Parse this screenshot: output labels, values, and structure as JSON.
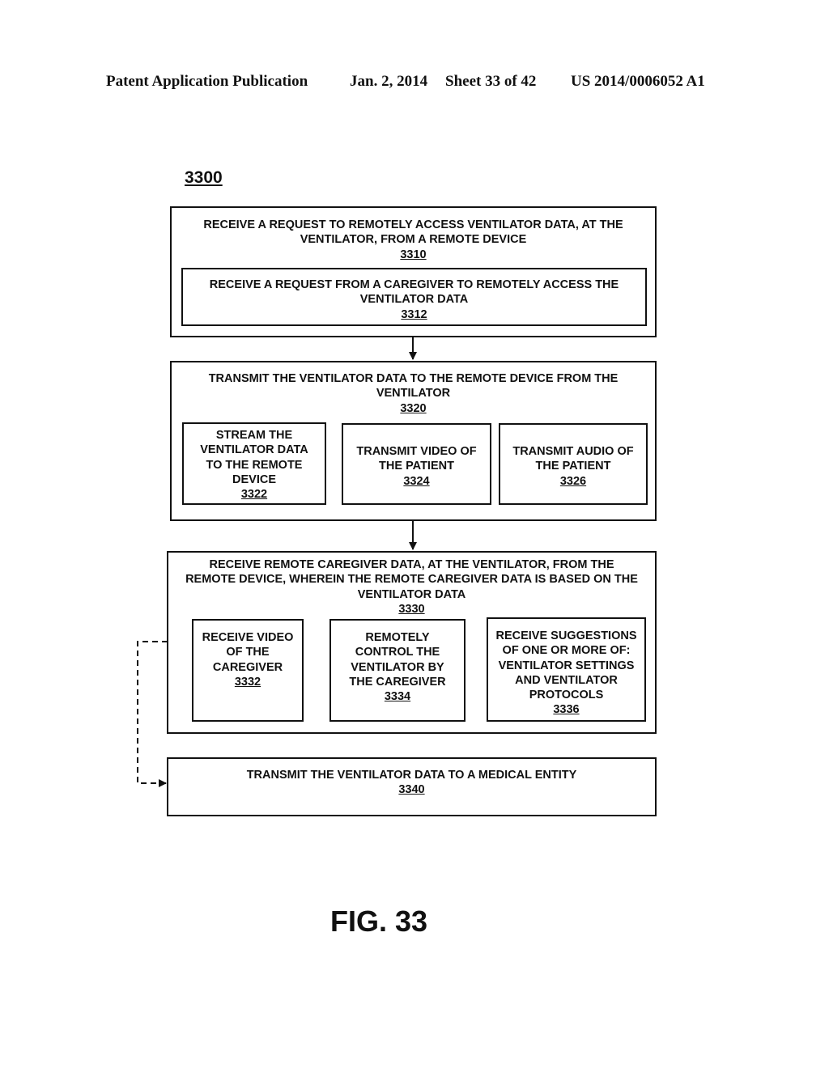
{
  "header": {
    "publication": "Patent Application Publication",
    "date": "Jan. 2, 2014",
    "sheet": "Sheet 33 of 42",
    "number": "US 2014/0006052 A1"
  },
  "diagram": {
    "ref": "3300",
    "figure_label": "FIG. 33",
    "steps": [
      {
        "label": "RECEIVE A REQUEST TO REMOTELY ACCESS VENTILATOR DATA, AT THE\nVENTILATOR, FROM A REMOTE DEVICE",
        "ref": "3310",
        "substeps": [
          {
            "label": "RECEIVE A REQUEST FROM A CAREGIVER TO REMOTELY ACCESS THE\nVENTILATOR DATA",
            "ref": "3312"
          }
        ]
      },
      {
        "label": "TRANSMIT THE VENTILATOR DATA TO THE REMOTE DEVICE FROM THE\nVENTILATOR",
        "ref": "3320",
        "substeps": [
          {
            "label": "STREAM THE\nVENTILATOR DATA\nTO THE REMOTE\nDEVICE",
            "ref": "3322"
          },
          {
            "label": "TRANSMIT VIDEO OF\nTHE PATIENT",
            "ref": "3324"
          },
          {
            "label": "TRANSMIT AUDIO OF\nTHE PATIENT",
            "ref": "3326"
          }
        ]
      },
      {
        "label": "RECEIVE REMOTE CAREGIVER DATA, AT THE VENTILATOR, FROM THE\nREMOTE DEVICE, WHEREIN THE REMOTE CAREGIVER DATA IS BASED ON THE\nVENTILATOR DATA",
        "ref": "3330",
        "substeps": [
          {
            "label": "RECEIVE VIDEO\nOF THE\nCAREGIVER",
            "ref": "3332"
          },
          {
            "label": "REMOTELY\nCONTROL THE\nVENTILATOR BY\nTHE CAREGIVER",
            "ref": "3334"
          },
          {
            "label": "RECEIVE SUGGESTIONS\nOF ONE OR MORE OF:\nVENTILATOR SETTINGS\nAND VENTILATOR\nPROTOCOLS",
            "ref": "3336"
          }
        ]
      },
      {
        "label": "TRANSMIT THE VENTILATOR DATA TO A MEDICAL ENTITY",
        "ref": "3340",
        "substeps": []
      }
    ],
    "edges": [
      {
        "from": "3310",
        "to": "3320",
        "style": "solid"
      },
      {
        "from": "3320",
        "to": "3330",
        "style": "solid"
      },
      {
        "from": "3330",
        "to": "3340",
        "style": "dashed"
      }
    ]
  }
}
